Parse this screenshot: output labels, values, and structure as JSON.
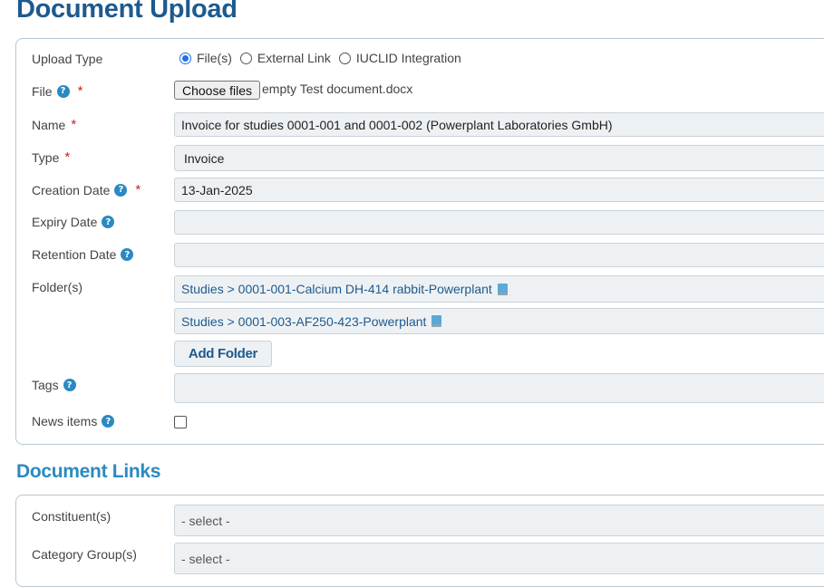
{
  "page_title": "Document Upload",
  "upload": {
    "upload_type_label": "Upload Type",
    "upload_type_options": [
      "File(s)",
      "External Link",
      "IUCLID Integration"
    ],
    "upload_type_selected": "File(s)",
    "file_label": "File",
    "choose_files_label": "Choose files",
    "file_name": "empty Test document.docx",
    "name_label": "Name",
    "name_value": "Invoice for studies 0001-001 and 0001-002 (Powerplant Laboratories GmbH)",
    "type_label": "Type",
    "type_value": "Invoice",
    "creation_date_label": "Creation Date",
    "creation_date_value": "13-Jan-2025",
    "expiry_date_label": "Expiry Date",
    "expiry_date_value": "",
    "retention_date_label": "Retention Date",
    "retention_date_value": "",
    "folders_label": "Folder(s)",
    "folders": [
      "Studies > 0001-001-Calcium DH-414 rabbit-Powerplant",
      "Studies > 0001-003-AF250-423-Powerplant"
    ],
    "add_folder_label": "Add Folder",
    "tags_label": "Tags",
    "tags_value": "",
    "news_items_label": "News items",
    "news_items_checked": false,
    "help_glyph": "?",
    "required_glyph": "*"
  },
  "links": {
    "title": "Document Links",
    "constituents_label": "Constituent(s)",
    "constituents_placeholder": "- select -",
    "category_groups_label": "Category Group(s)",
    "category_groups_placeholder": "- select -"
  },
  "colors": {
    "title": "#1d5a8e",
    "section_title": "#2a8ac1",
    "help_icon": "#2a8ac1",
    "required": "#cc2222",
    "field_bg": "#eef1f4"
  }
}
